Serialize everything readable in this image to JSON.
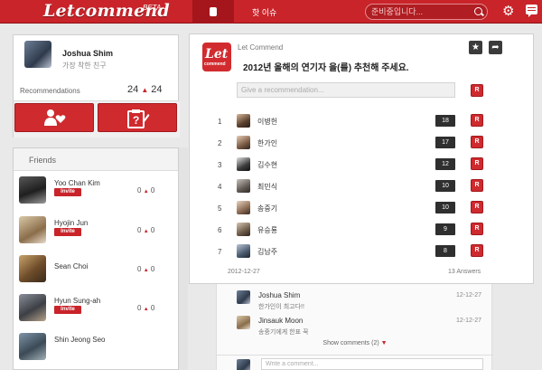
{
  "header": {
    "logo": "Letcommend",
    "beta": "BETA",
    "nav_issue": "핫 이슈",
    "search_placeholder": "준비중입니다..."
  },
  "profile": {
    "name": "Joshua Shim",
    "status": "가장 착한 친구",
    "recommendations_label": "Recommendations",
    "rec_left": "24",
    "rec_right": "24"
  },
  "friends": {
    "title": "Friends",
    "items": [
      {
        "name": "Yoo Chan Kim",
        "invite": "Invite",
        "up": "0",
        "down": "0"
      },
      {
        "name": "Hyojin Jun",
        "invite": "Invite",
        "up": "0",
        "down": "0"
      },
      {
        "name": "Sean Choi",
        "up": "0",
        "down": "0"
      },
      {
        "name": "Hyun Sung-ah",
        "invite": "Invite",
        "up": "0",
        "down": "0"
      },
      {
        "name": "Shin Jeong Seo",
        "up": "",
        "down": ""
      }
    ]
  },
  "card": {
    "app_name": "Let Commend",
    "logo_letters": "Let",
    "logo_sub": "commend",
    "question": "2012년 올해의 연기자 을(를) 추천해 주세요.",
    "input_placeholder": "Give a recommendation...",
    "r_label": "R",
    "candidates": [
      {
        "rank": "1",
        "name": "이병헌",
        "score": "18"
      },
      {
        "rank": "2",
        "name": "한가인",
        "score": "17"
      },
      {
        "rank": "3",
        "name": "김수현",
        "score": "12"
      },
      {
        "rank": "4",
        "name": "최민식",
        "score": "10"
      },
      {
        "rank": "5",
        "name": "송중기",
        "score": "10"
      },
      {
        "rank": "6",
        "name": "유승룡",
        "score": "9"
      },
      {
        "rank": "7",
        "name": "김남주",
        "score": "8"
      }
    ],
    "date": "2012-12-27",
    "answers": "13 Answers"
  },
  "comments": {
    "items": [
      {
        "name": "Joshua Shim",
        "text": "한가인이 최고다!!",
        "date": "12-12-27"
      },
      {
        "name": "Jinsauk Moon",
        "text": "송중기에게 한표 꾹",
        "date": "12-12-27"
      }
    ],
    "show_label": "Show comments (2)",
    "write_placeholder": "Write a comment..."
  }
}
